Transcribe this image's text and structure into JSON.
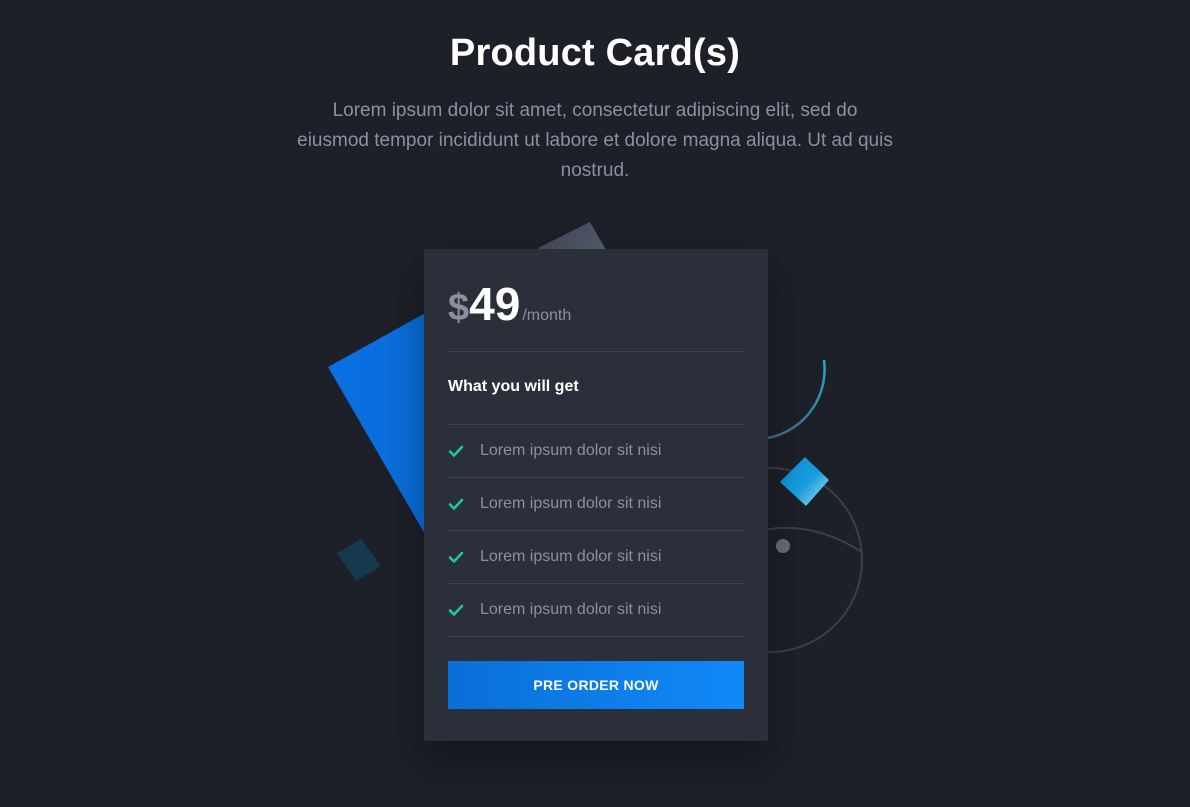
{
  "header": {
    "title": "Product Card(s)",
    "subtitle": "Lorem ipsum dolor sit amet, consectetur adipiscing elit, sed do eiusmod tempor incididunt ut labore et dolore magna aliqua. Ut ad quis nostrud."
  },
  "card": {
    "currency": "$",
    "amount": "49",
    "period": "/month",
    "features_heading": "What you will get",
    "features": [
      {
        "label": "Lorem ipsum dolor sit nisi",
        "icon": "check-icon"
      },
      {
        "label": "Lorem ipsum dolor sit nisi",
        "icon": "check-icon"
      },
      {
        "label": "Lorem ipsum dolor sit nisi",
        "icon": "check-icon"
      },
      {
        "label": "Lorem ipsum dolor sit nisi",
        "icon": "check-icon"
      }
    ],
    "cta_label": "PRE ORDER NOW"
  },
  "colors": {
    "background": "#1d2028",
    "card": "#2b2f3a",
    "accent_blue": "#1089f7",
    "check_green": "#1ec8a5",
    "muted_text": "#8b90a1"
  }
}
